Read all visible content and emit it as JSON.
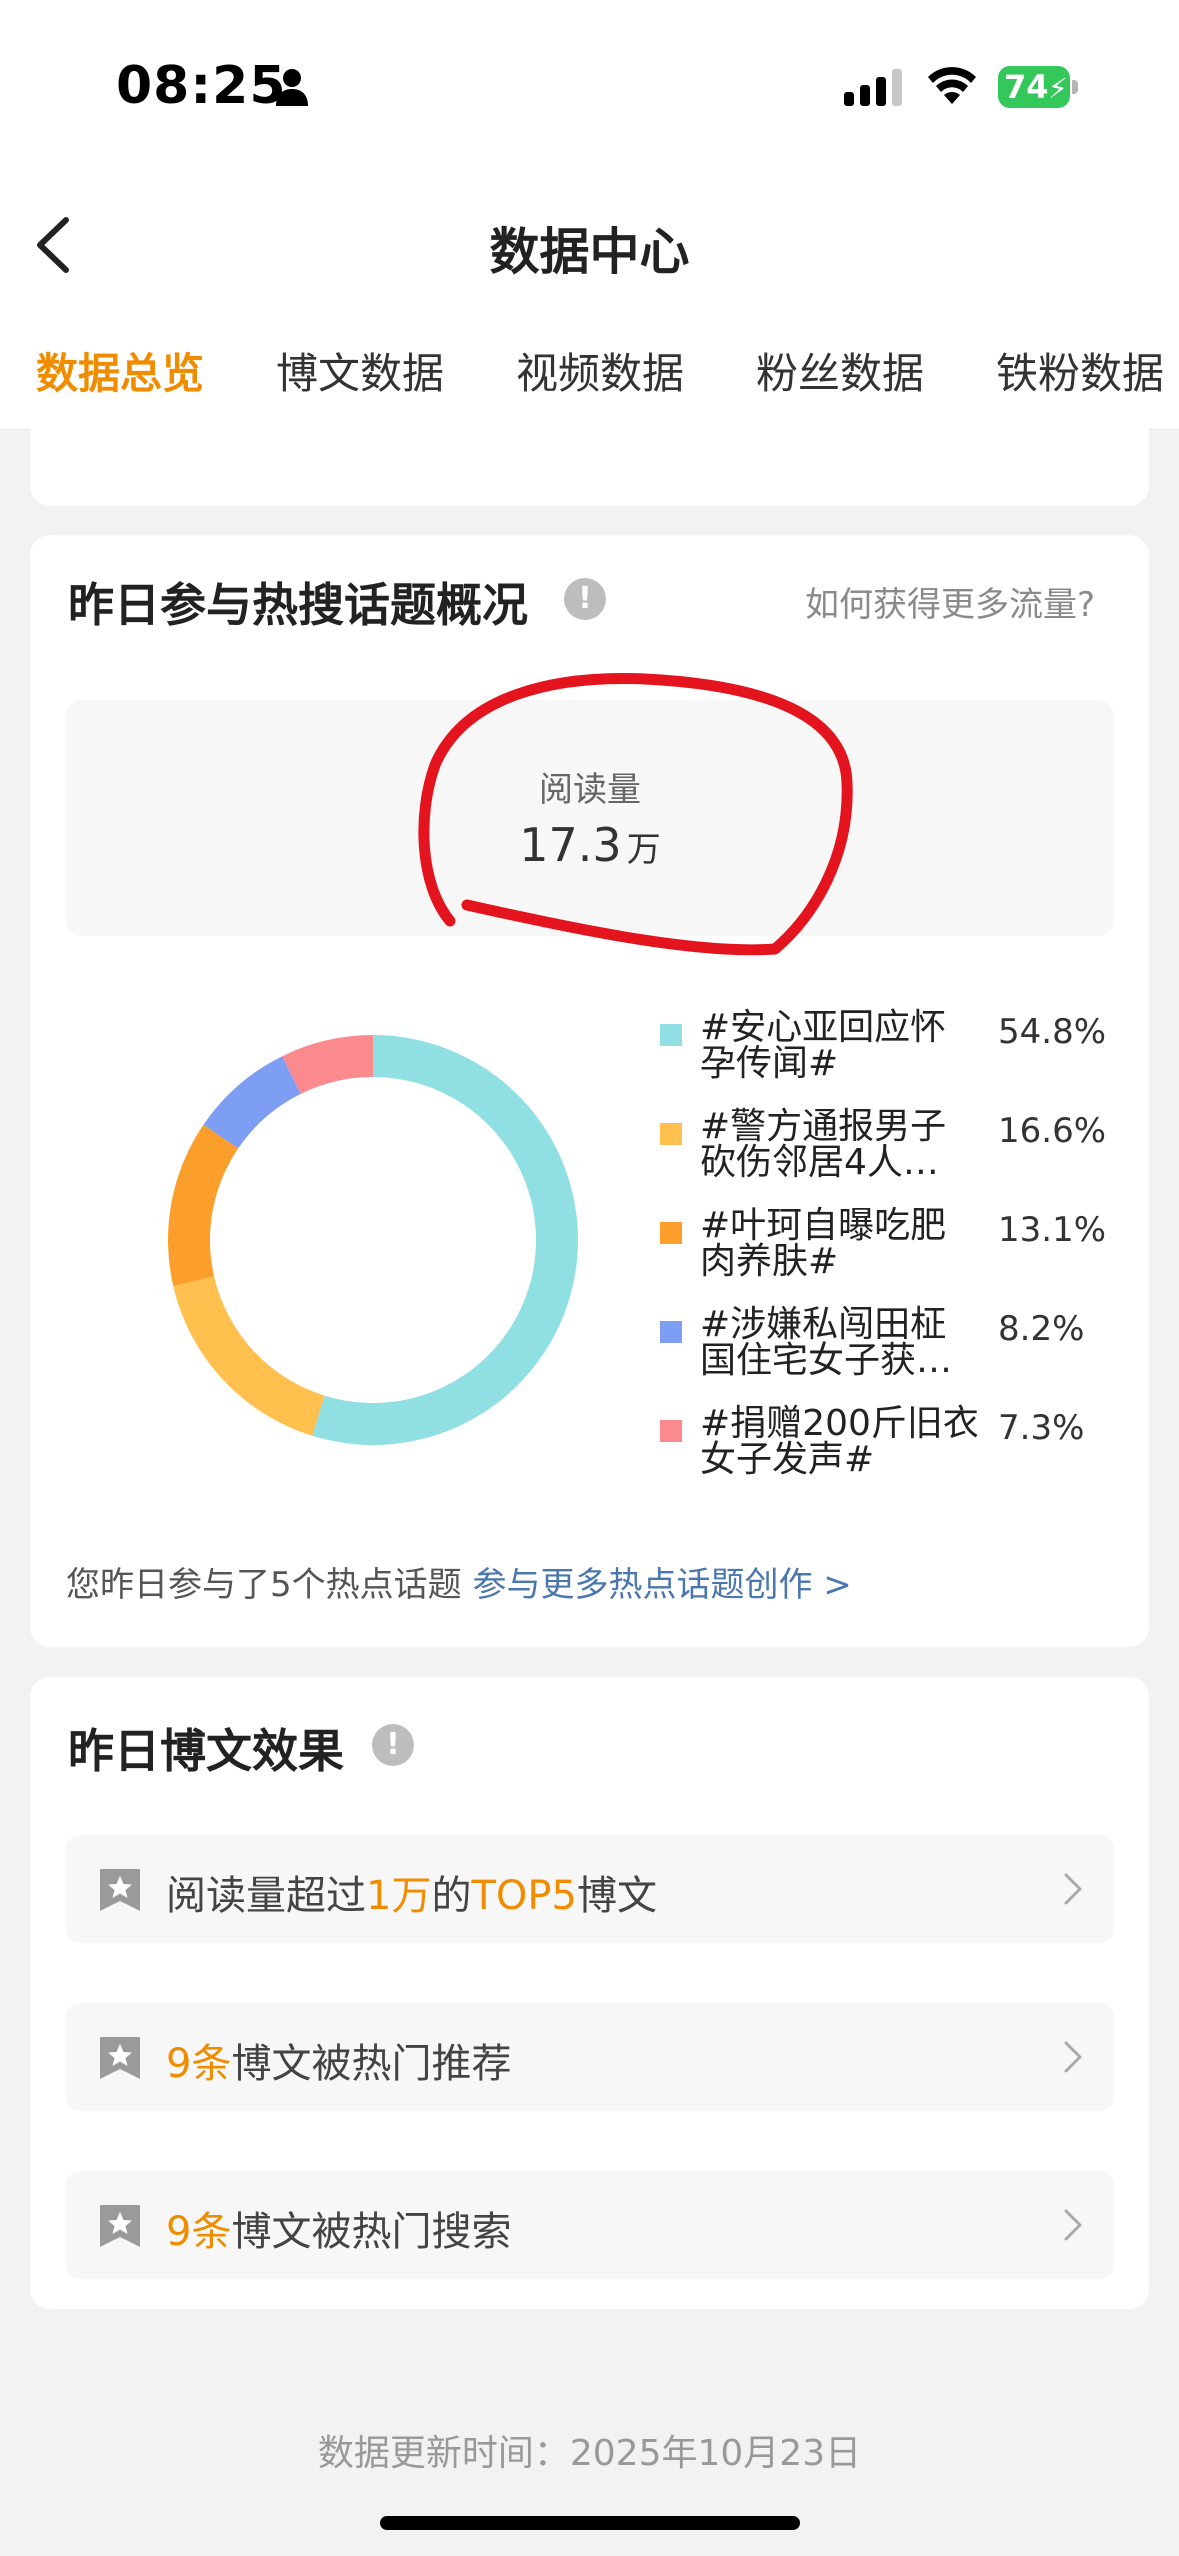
{
  "status_bar": {
    "time": "08:25",
    "battery": "74"
  },
  "nav": {
    "title": "数据中心"
  },
  "tabs": [
    {
      "label": "数据总览",
      "active": true
    },
    {
      "label": "博文数据",
      "active": false
    },
    {
      "label": "视频数据",
      "active": false
    },
    {
      "label": "粉丝数据",
      "active": false
    },
    {
      "label": "铁粉数据",
      "active": false
    }
  ],
  "hot_topics": {
    "title": "昨日参与热搜话题概况",
    "more_traffic": "如何获得更多流量?",
    "read_label": "阅读量",
    "read_value": "17.3",
    "read_unit": "万",
    "footer_text": "您昨日参与了5个热点话题",
    "footer_link": "参与更多热点话题创作 >"
  },
  "chart_data": {
    "type": "pie",
    "categories": [
      "#安心亚回应怀孕传闻#",
      "#警方通报男子砍伤邻居4人…",
      "#叶珂自曝吃肥肉养肤#",
      "#涉嫌私闯田柾国住宅女子获…",
      "#捐赠200斤旧衣女子发声#"
    ],
    "values": [
      54.8,
      16.6,
      13.1,
      8.2,
      7.3
    ],
    "labels": [
      "54.8%",
      "16.6%",
      "13.1%",
      "8.2%",
      "7.3%"
    ],
    "colors": [
      "#8fdfe3",
      "#ffc04d",
      "#fb9e2c",
      "#7e9ef3",
      "#fb8a8e"
    ],
    "legend_lines": [
      [
        "#安心亚回应怀",
        "孕传闻#"
      ],
      [
        "#警方通报男子",
        "砍伤邻居4人…"
      ],
      [
        "#叶珂自曝吃肥",
        "肉养肤#"
      ],
      [
        "#涉嫌私闯田柾",
        "国住宅女子获…"
      ],
      [
        "#捐赠200斤旧衣",
        "女子发声#"
      ]
    ],
    "legend_position": "right"
  },
  "effect": {
    "title": "昨日博文效果",
    "rows": [
      {
        "pre": "阅读量超过",
        "hl1": "1万",
        "mid": "的",
        "hl2": "TOP5",
        "post": "博文"
      },
      {
        "hl1": "9条",
        "post": "博文被热门推荐"
      },
      {
        "hl1": "9条",
        "post": "博文被热门搜索"
      }
    ]
  },
  "update_time": "数据更新时间：2025年10月23日"
}
